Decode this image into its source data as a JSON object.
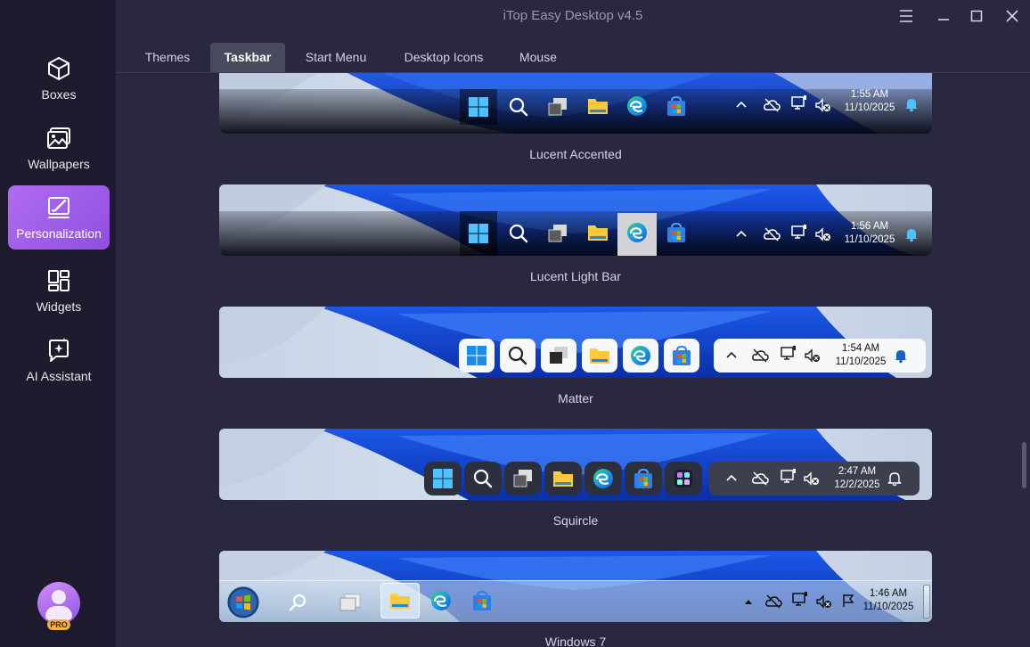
{
  "window": {
    "title": "iTop Easy Desktop v4.5"
  },
  "sidebar": {
    "items": [
      {
        "label": "Boxes",
        "icon": "box-icon"
      },
      {
        "label": "Wallpapers",
        "icon": "image-icon"
      },
      {
        "label": "Personalization",
        "icon": "brush-icon",
        "active": true
      },
      {
        "label": "Widgets",
        "icon": "widgets-icon"
      },
      {
        "label": "AI Assistant",
        "icon": "ai-sparkle-icon"
      }
    ],
    "badge": "PRO"
  },
  "tabs": [
    {
      "label": "Themes"
    },
    {
      "label": "Taskbar",
      "active": true
    },
    {
      "label": "Start Menu"
    },
    {
      "label": "Desktop Icons"
    },
    {
      "label": "Mouse"
    }
  ],
  "taskbars": [
    {
      "name": "Lucent Accented",
      "time": "1:55 AM",
      "date": "11/10/2025"
    },
    {
      "name": "Lucent Light Bar",
      "time": "1:56 AM",
      "date": "11/10/2025"
    },
    {
      "name": "Matter",
      "time": "1:54 AM",
      "date": "11/10/2025"
    },
    {
      "name": "Squircle",
      "time": "2:47 AM",
      "date": "12/2/2025"
    },
    {
      "name": "Windows 7",
      "time": "1:46 AM",
      "date": "11/10/2025"
    }
  ],
  "colors": {
    "accent": "#9b5de5",
    "sidebar_bg": "#1d1b2d",
    "content_bg": "#2a2840",
    "pro_badge": "#f2b23a"
  }
}
